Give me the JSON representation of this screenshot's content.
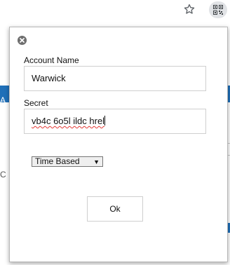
{
  "popup": {
    "account_name_label": "Account Name",
    "account_name_value": "Warwick",
    "secret_label": "Secret",
    "secret_value": "vb4c 6o5l ildc hrel",
    "type_select": {
      "selected": "Time Based",
      "options": [
        "Time Based"
      ]
    },
    "ok_label": "Ok"
  },
  "background": {
    "left_char": "A",
    "left_char2": "C"
  },
  "icons": {
    "bookmark": "star-icon",
    "extension": "qr-code-icon",
    "close": "close-icon",
    "dropdown": "triangle-down-icon"
  },
  "colors": {
    "page_accent": "#1f6fb8",
    "extension_button_bg": "#e1e3e6",
    "spellcheck": "#e53935"
  }
}
